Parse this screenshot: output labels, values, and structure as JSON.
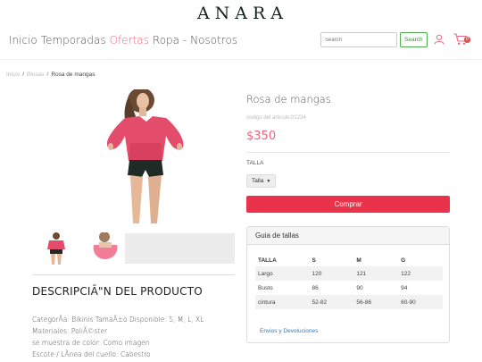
{
  "brand": {
    "logo": "ANARA"
  },
  "nav": [
    {
      "label": "Inicio",
      "active": false
    },
    {
      "label": "Temporadas",
      "active": false
    },
    {
      "label": "Ofertas",
      "active": true
    },
    {
      "label": "Ropa -",
      "active": false
    },
    {
      "label": "Nosotros",
      "active": false
    }
  ],
  "search": {
    "placeholder": "Search",
    "button": "Search"
  },
  "cart": {
    "count": "0"
  },
  "breadcrumb": {
    "home": "Inicio",
    "section": "Blusas",
    "current": "Rosa de mangas"
  },
  "product": {
    "title": "Rosa de mangas",
    "code": "codigo del articulo:01234",
    "price": "$350",
    "size_label": "TALLA",
    "size_select": "Talla",
    "buy_button": "Comprar"
  },
  "description": {
    "title": "DESCRIPCIÃ\"N DEL PRODUCTO",
    "lines": [
      "CategorÃ­a: Bikinis TamaÃ±o Disponible: S, M, L, XL",
      "Materiales: PoliÃ©ster",
      "se muestra de color: Como imagen",
      "Escote / LÃ­nea del cuello: Cabestro"
    ]
  },
  "size_guide": {
    "title": "Guia de tallas",
    "headers": [
      "TALLA",
      "S",
      "M",
      "G"
    ],
    "rows": [
      [
        "Largo",
        "120",
        "121",
        "122"
      ],
      [
        "Busto",
        "86",
        "90",
        "94"
      ],
      [
        "cintura",
        "52-82",
        "56-86",
        "60-90"
      ]
    ],
    "link": "Envios y Devoluciones"
  },
  "colors": {
    "accent": "#e8677c",
    "buy": "#e8334a",
    "link": "#337ab7"
  }
}
